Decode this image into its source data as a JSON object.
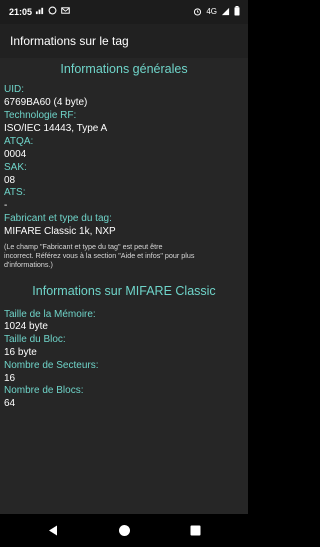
{
  "status_bar": {
    "time": "21:05",
    "icons_left": [
      "signal-bars-icon",
      "whatsapp-icon",
      "mail-icon"
    ],
    "icons_right": [
      "alarm-icon",
      "network-4g-icon",
      "cell-signal-icon",
      "battery-icon"
    ],
    "network_label": "4G"
  },
  "app_bar": {
    "title": "Informations sur le tag"
  },
  "general": {
    "heading": "Informations générales",
    "uid_label": "UID:",
    "uid_value": "6769BA60 (4 byte)",
    "rf_label": "Technologie RF:",
    "rf_value": "ISO/IEC 14443, Type A",
    "atqa_label": "ATQA:",
    "atqa_value": "0004",
    "sak_label": "SAK:",
    "sak_value": "08",
    "ats_label": "ATS:",
    "ats_value": "-",
    "manufacturer_label": "Fabricant et type du tag:",
    "manufacturer_value": "MIFARE Classic 1k, NXP",
    "note_line1": "(Le champ \"Fabricant et type du tag\" est peut être",
    "note_line2": "incorrect. Référez vous à la section \"Aide et infos\" pour plus",
    "note_line3": "d'informations.)"
  },
  "mifare": {
    "heading": "Informations sur MIFARE Classic",
    "memory_label": "Taille de la Mémoire:",
    "memory_value": "1024 byte",
    "block_size_label": "Taille du Bloc:",
    "block_size_value": "16 byte",
    "sectors_label": "Nombre de Secteurs:",
    "sectors_value": "16",
    "blocks_label": "Nombre de Blocs:",
    "blocks_value": "64"
  },
  "nav_bar": {
    "icons": [
      "back-icon",
      "home-icon",
      "recents-icon"
    ]
  }
}
